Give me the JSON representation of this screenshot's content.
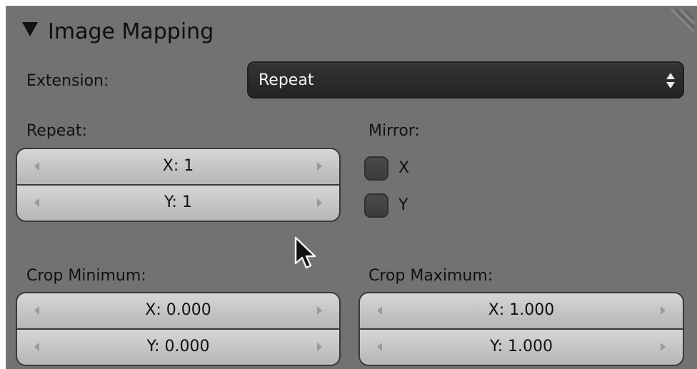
{
  "panel": {
    "title": "Image Mapping",
    "collapse_icon": "triangle-down-icon",
    "grip_icon": "drag-grip-icon"
  },
  "extension": {
    "label": "Extension:",
    "value": "Repeat",
    "dropdown_icon": "up-down-arrows-icon"
  },
  "repeat": {
    "label": "Repeat:",
    "x": "X: 1",
    "y": "Y: 1"
  },
  "mirror": {
    "label": "Mirror:",
    "x_label": "X",
    "y_label": "Y",
    "x_checked": false,
    "y_checked": false
  },
  "crop_minimum": {
    "label": "Crop Minimum:",
    "x": "X: 0.000",
    "y": "Y: 0.000"
  },
  "crop_maximum": {
    "label": "Crop Maximum:",
    "x": "X: 1.000",
    "y": "Y: 1.000"
  },
  "colors": {
    "panel_bg": "#727272",
    "field_bg": "#c4c4c4",
    "dropdown_bg": "#2a2a2a",
    "dropdown_text": "#f2f2f2"
  }
}
